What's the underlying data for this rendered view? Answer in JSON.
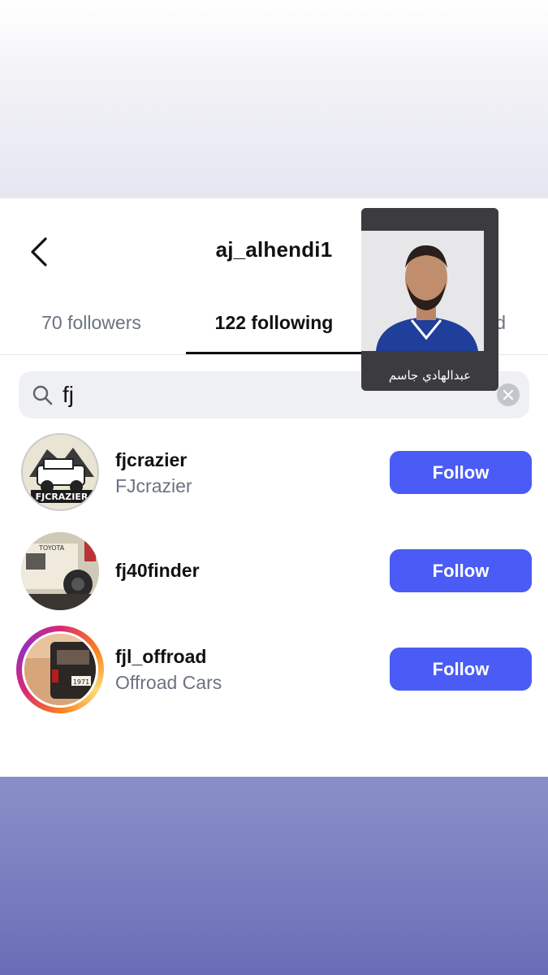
{
  "header": {
    "title": "aj_alhendi1",
    "back_icon": "chevron-left-icon"
  },
  "tabs": [
    {
      "label": "70 followers",
      "active": false
    },
    {
      "label": "122 following",
      "active": true
    },
    {
      "label": "d",
      "active": false
    }
  ],
  "search": {
    "value": "fj",
    "icon": "search-icon",
    "clear_icon": "close-icon"
  },
  "results": [
    {
      "username": "fjcrazier",
      "name": "FJcrazier",
      "button": "Follow",
      "avatar_text": "FJCRAZIER"
    },
    {
      "username": "fj40finder",
      "name": "",
      "button": "Follow",
      "avatar_text": "TOYOTA"
    },
    {
      "username": "fjl_offroad",
      "name": "Offroad Cars",
      "button": "Follow",
      "story_ring": true,
      "avatar_text": "1971"
    }
  ],
  "overlay": {
    "caption": "عبدالهادي جاسم"
  },
  "colors": {
    "accent": "#4a5cf5",
    "muted": "#6b7280",
    "bottom_gradient": "#7b7fc0"
  }
}
